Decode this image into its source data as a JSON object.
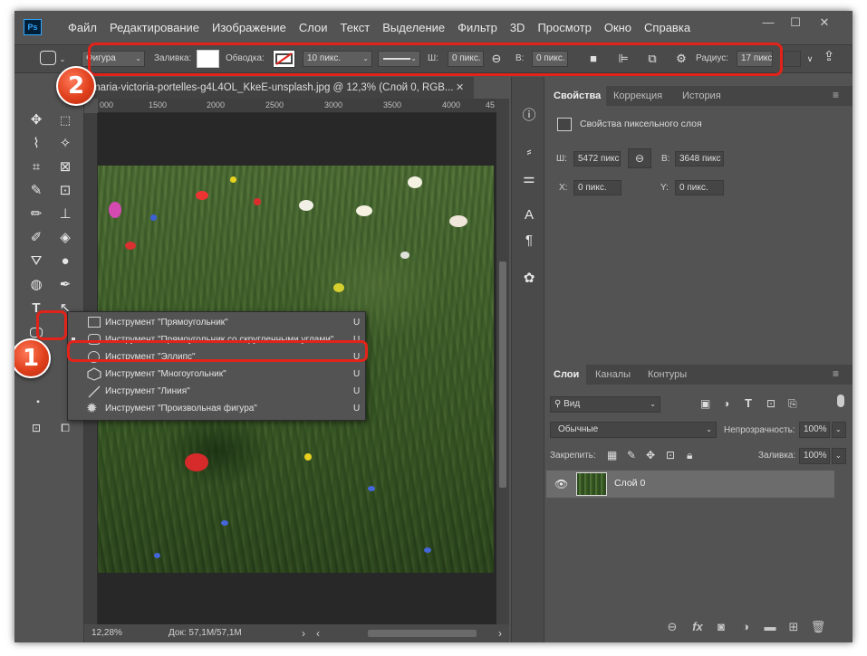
{
  "app": {
    "logo": "Ps"
  },
  "menu": [
    "Файл",
    "Редактирование",
    "Изображение",
    "Слои",
    "Текст",
    "Выделение",
    "Фильтр",
    "3D",
    "Просмотр",
    "Окно",
    "Справка"
  ],
  "window_controls": {
    "minimize": "—",
    "maximize": "☐",
    "close": "✕"
  },
  "options_bar": {
    "mode": "Фигура",
    "fill_label": "Заливка:",
    "stroke_label": "Обводка:",
    "stroke_width": "10 пикс.",
    "w_label": "Ш:",
    "w_value": "0 пикс.",
    "h_label": "В:",
    "h_value": "0 пикс.",
    "radius_label": "Радиус:",
    "radius_value": "17 пикс"
  },
  "document": {
    "tab_title": "maria-victoria-portelles-g4L4OL_KkeE-unsplash.jpg @ 12,3% (Слой 0, RGB...",
    "ruler_ticks": [
      "000",
      "1500",
      "2000",
      "2500",
      "3000",
      "3500",
      "4000",
      "45"
    ],
    "zoom": "12,28%",
    "doc_info": "Док: 57,1M/57,1M"
  },
  "flyout": {
    "items": [
      {
        "label": "Инструмент \"Прямоугольник\"",
        "key": "U",
        "icon": "rectangle-icon"
      },
      {
        "label": "Инструмент \"Прямоугольник со скругленными углами\"",
        "key": "U",
        "icon": "rounded-rectangle-icon"
      },
      {
        "label": "Инструмент \"Эллипс\"",
        "key": "U",
        "icon": "ellipse-icon"
      },
      {
        "label": "Инструмент \"Многоугольник\"",
        "key": "U",
        "icon": "polygon-icon"
      },
      {
        "label": "Инструмент \"Линия\"",
        "key": "U",
        "icon": "line-icon"
      },
      {
        "label": "Инструмент \"Произвольная фигура\"",
        "key": "U",
        "icon": "custom-shape-icon"
      }
    ]
  },
  "badges": {
    "one": "1",
    "two": "2"
  },
  "properties": {
    "tabs": [
      "Свойства",
      "Коррекция",
      "История"
    ],
    "title": "Свойства пиксельного слоя",
    "w_label": "Ш:",
    "w_value": "5472 пикс",
    "h_label": "В:",
    "h_value": "3648 пикс",
    "x_label": "X:",
    "x_value": "0 пикс.",
    "y_label": "Y:",
    "y_value": "0 пикс."
  },
  "layers": {
    "tabs": [
      "Слои",
      "Каналы",
      "Контуры"
    ],
    "filter": "Вид",
    "blend_mode": "Обычные",
    "opacity_label": "Непрозрачность:",
    "opacity_value": "100%",
    "lock_label": "Закрепить:",
    "fill_label": "Заливка:",
    "fill_value": "100%",
    "layer_name": "Слой 0"
  },
  "colors": {
    "highlight": "#e2231a",
    "badge": "#e0401c",
    "ui_bg": "#535353"
  }
}
